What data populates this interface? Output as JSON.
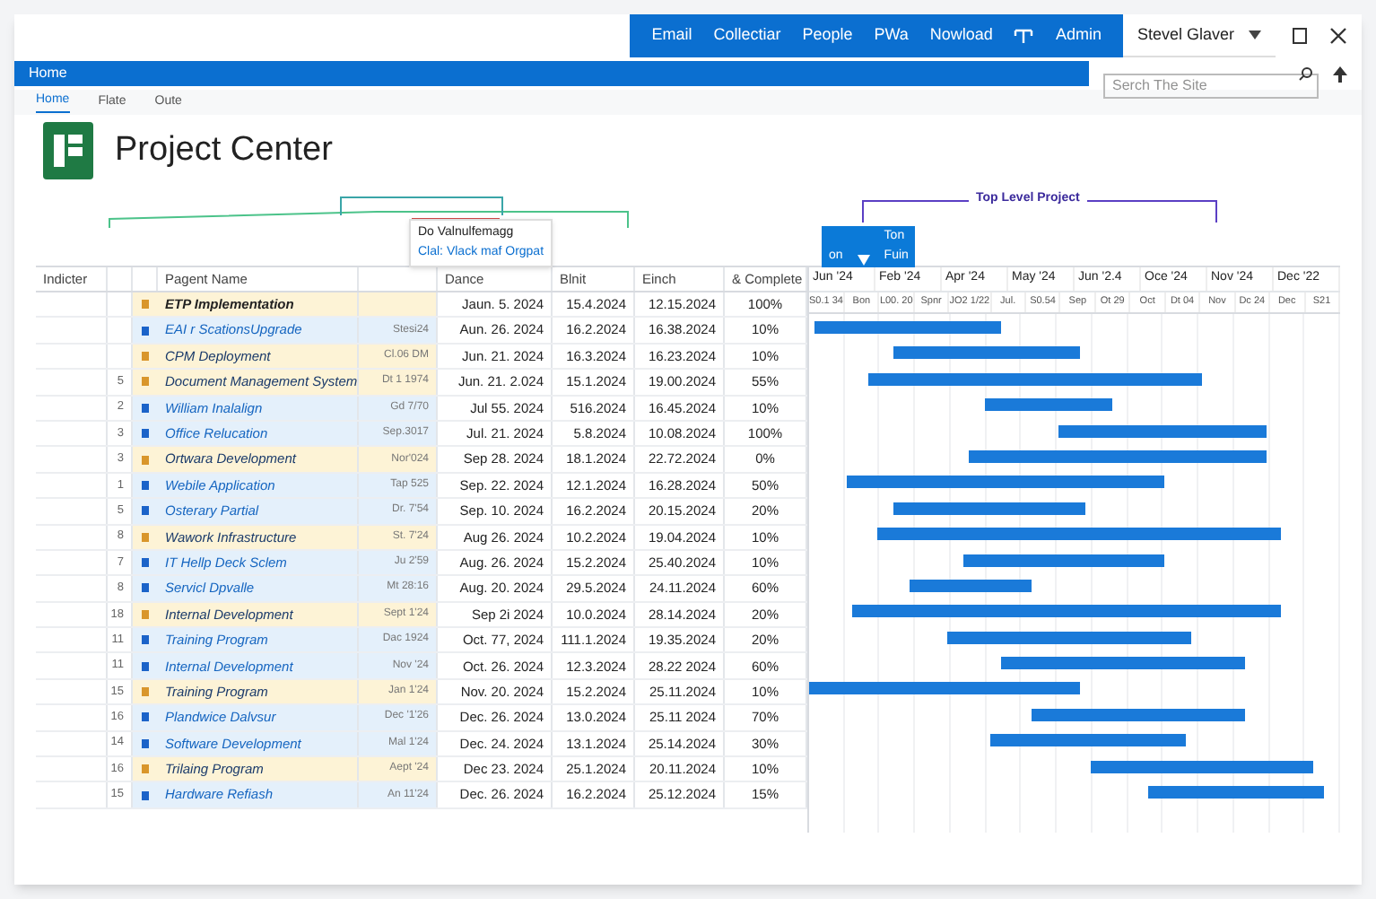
{
  "top_nav": {
    "links": [
      "Email",
      "Collectiar",
      "People",
      "PWa",
      "Nowload",
      "Admin"
    ]
  },
  "user_menu": {
    "name": "Stevel Glaver"
  },
  "search": {
    "placeholder": "Serch The Site"
  },
  "ribbon": {
    "title": "Home"
  },
  "tabs": [
    {
      "label": "Home",
      "selected": true
    },
    {
      "label": "Flate",
      "selected": false
    },
    {
      "label": "Oute",
      "selected": false
    }
  ],
  "page_title": "Project Center",
  "hierarchy": {
    "tooltip_title": "Do Valnulfemagg",
    "tooltip_link": "Clal: Vlack maf Orgpat",
    "top_level_label": "Top Level Project",
    "box_lines": [
      "Ton",
      "Fuin"
    ],
    "box_tag": "on"
  },
  "table": {
    "columns": [
      "Indicter",
      "Pagent Name",
      "Dance",
      "Blnit",
      "Einch",
      "& Complete"
    ],
    "rows": [
      {
        "indicator": "",
        "name": "ETP Implementation",
        "column_3": "",
        "kind": "group",
        "start": "Jaun. 5. 2024",
        "column_7": "15.4.2024",
        "finish": "12.15.2024",
        "complete": "100%"
      },
      {
        "indicator": "",
        "name": "EAI r  ScationsUpgrade",
        "column_3": "Stesi24",
        "kind": "task",
        "start": "Aun. 26. 2024",
        "column_7": "16.2.2024",
        "finish": "16.38.2024",
        "complete": "10%"
      },
      {
        "indicator": "",
        "name": "CPM Deployment",
        "column_3": "Cl.06 DM",
        "kind": "group",
        "start": "Jun. 21. 2024",
        "column_7": "16.3.2024",
        "finish": "16.23.2024",
        "complete": "10%"
      },
      {
        "indicator": "5",
        "name": "Document Management System",
        "column_3": "Dt 1 1974",
        "kind": "group",
        "start": "Jun. 21. 2.024",
        "column_7": "15.1.2024",
        "finish": "19.00.2024",
        "complete": "55%"
      },
      {
        "indicator": "2",
        "name": "William Inalalign",
        "column_3": "Gd 7/70",
        "kind": "task",
        "start": "Jul 55. 2024",
        "column_7": "516.2024",
        "finish": "16.45.2024",
        "complete": "10%"
      },
      {
        "indicator": "3",
        "name": "Office Relucation",
        "column_3": "Sep.3017",
        "kind": "task",
        "start": "Jul. 21. 2024",
        "column_7": "5.8.2024",
        "finish": "10.08.2024",
        "complete": "100%"
      },
      {
        "indicator": "3",
        "name": "Ortwara Development",
        "column_3": "Nor'024",
        "kind": "group",
        "start": "Sep 28. 2024",
        "column_7": "18.1.2024",
        "finish": "22.72.2024",
        "complete": "0%"
      },
      {
        "indicator": "1",
        "name": "Webile Application",
        "column_3": "Tap 525",
        "kind": "task",
        "start": "Sep. 22. 2024",
        "column_7": "12.1.2024",
        "finish": "16.28.2024",
        "complete": "50%"
      },
      {
        "indicator": "5",
        "name": "Osterary Partial",
        "column_3": "Dr. 7'54",
        "kind": "task",
        "start": "Sep. 10. 2024",
        "column_7": "16.2.2024",
        "finish": "20.15.2024",
        "complete": "20%"
      },
      {
        "indicator": "8",
        "name": "Wawork Infrastructure",
        "column_3": "St. 7'24",
        "kind": "group",
        "start": "Aug 26. 2024",
        "column_7": "10.2.2024",
        "finish": "19.04.2024",
        "complete": "10%"
      },
      {
        "indicator": "7",
        "name": "IT Hellp Deck Sclem",
        "column_3": "Ju 2'59",
        "kind": "task",
        "start": "Aug. 26. 2024",
        "column_7": "15.2.2024",
        "finish": "25.40.2024",
        "complete": "10%"
      },
      {
        "indicator": "8",
        "name": "Servicl Dpvalle",
        "column_3": "Mt 28:16",
        "kind": "task",
        "start": "Aug. 20. 2024",
        "column_7": "29.5.2024",
        "finish": "24.11.2024",
        "complete": "60%"
      },
      {
        "indicator": "18",
        "name": "Internal Development",
        "column_3": "Sept 1'24",
        "kind": "group",
        "start": "Sep 2i 2024",
        "column_7": "10.0.2024",
        "finish": "28.14.2024",
        "complete": "20%"
      },
      {
        "indicator": "11",
        "name": "Training Program",
        "column_3": "Dac 1924",
        "kind": "task",
        "start": "Oct. 77, 2024",
        "column_7": "111.1.2024",
        "finish": "19.35.2024",
        "complete": "20%"
      },
      {
        "indicator": "11",
        "name": "Internal Development",
        "column_3": "Nov '24",
        "kind": "task",
        "start": "Oct. 26. 2024",
        "column_7": "12.3.2024",
        "finish": "28.22 2024",
        "complete": "60%"
      },
      {
        "indicator": "15",
        "name": "Training Program",
        "column_3": "Jan 1'24",
        "kind": "group",
        "start": "Nov. 20. 2024",
        "column_7": "15.2.2024",
        "finish": "25.11.2024",
        "complete": "10%"
      },
      {
        "indicator": "16",
        "name": "Plandwice Dalvsur",
        "column_3": "Dec '1'26",
        "kind": "task",
        "start": "Dec. 26. 2024",
        "column_7": "13.0.2024",
        "finish": "25.11 2024",
        "complete": "70%"
      },
      {
        "indicator": "14",
        "name": "Software Development",
        "column_3": "Mal 1'24",
        "kind": "task",
        "start": "Dec. 24. 2024",
        "column_7": "13.1.2024",
        "finish": "25.14.2024",
        "complete": "30%"
      },
      {
        "indicator": "16",
        "name": "Trilaing Program",
        "column_3": "Aept '24",
        "kind": "group",
        "start": "Dec 23. 2024",
        "column_7": "25.1.2024",
        "finish": "20.11.2024",
        "complete": "10%"
      },
      {
        "indicator": "15",
        "name": "Hardware Refiash",
        "column_3": "An 11'24",
        "kind": "task",
        "start": "Dec. 26. 2024",
        "column_7": "16.2.2024",
        "finish": "25.12.2024",
        "complete": "15%"
      }
    ]
  },
  "gantt": {
    "months": [
      "Jun '24",
      "Feb '24",
      "Apr '24",
      "May '24",
      "Jun '2.4",
      "Oce '24",
      "Nov '24",
      "Dec '22"
    ],
    "subheaders": [
      "S0.1 34",
      "Bon",
      "L00. 20",
      "Spnr",
      "JO2 1/22",
      "Jul.",
      "S0.54",
      "Sep",
      "Ot 29",
      "Oct",
      "Dt 04",
      "Nov",
      "Dc 24",
      "Dec",
      "S21"
    ]
  }
}
